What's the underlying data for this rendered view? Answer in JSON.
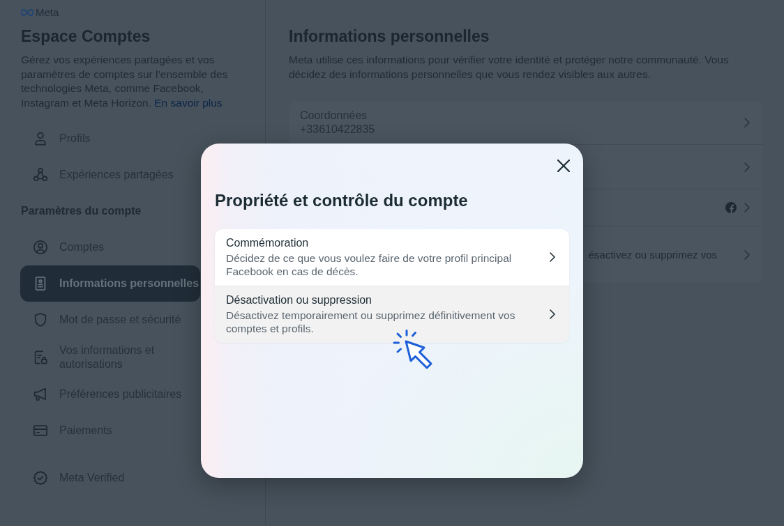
{
  "sidebar": {
    "brand": "Meta",
    "title": "Espace Comptes",
    "description": "Gérez vos expériences partagées et vos paramètres de comptes sur l’ensemble des technologies Meta, comme Facebook, Instagram et Meta Horizon.",
    "link": "En savoir plus",
    "items": [
      {
        "label": "Profils",
        "selected": false
      },
      {
        "label": "Expériences partagées",
        "selected": false
      }
    ],
    "section": {
      "title": "Paramètres du compte",
      "items": [
        {
          "label": "Comptes",
          "selected": false
        },
        {
          "label": "Informations personnelles",
          "selected": true
        },
        {
          "label": "Mot de passe et sécurité",
          "selected": false
        },
        {
          "label": "Vos informations et autorisations",
          "selected": false
        },
        {
          "label": "Préférences publicitaires",
          "selected": false
        },
        {
          "label": "Paiements",
          "selected": false
        }
      ]
    },
    "bottom_items": [
      {
        "label": "Meta Verified",
        "selected": false
      }
    ]
  },
  "main": {
    "title": "Informations personnelles",
    "description": "Meta utilise ces informations pour vérifier votre identité et protéger notre communauté. Vous décidez des informations personnelles que vous rendez visibles aux autres.",
    "rows": [
      {
        "kind": "detail",
        "label": "Coordonnées",
        "value": "+33610422835"
      },
      {
        "kind": "covered"
      },
      {
        "kind": "linked"
      },
      {
        "kind": "partial",
        "text": "ésactivez ou supprimez vos"
      }
    ]
  },
  "dialog": {
    "title": "Propriété et contrôle du compte",
    "options": [
      {
        "title": "Commémoration",
        "description": "Décidez de ce que vous voulez faire de votre profil principal Facebook en cas de décès.",
        "highlighted": false
      },
      {
        "title": "Désactivation ou suppression",
        "description": "Désactivez temporairement ou supprimez définitivement vos comptes et profils.",
        "highlighted": true
      }
    ]
  }
}
